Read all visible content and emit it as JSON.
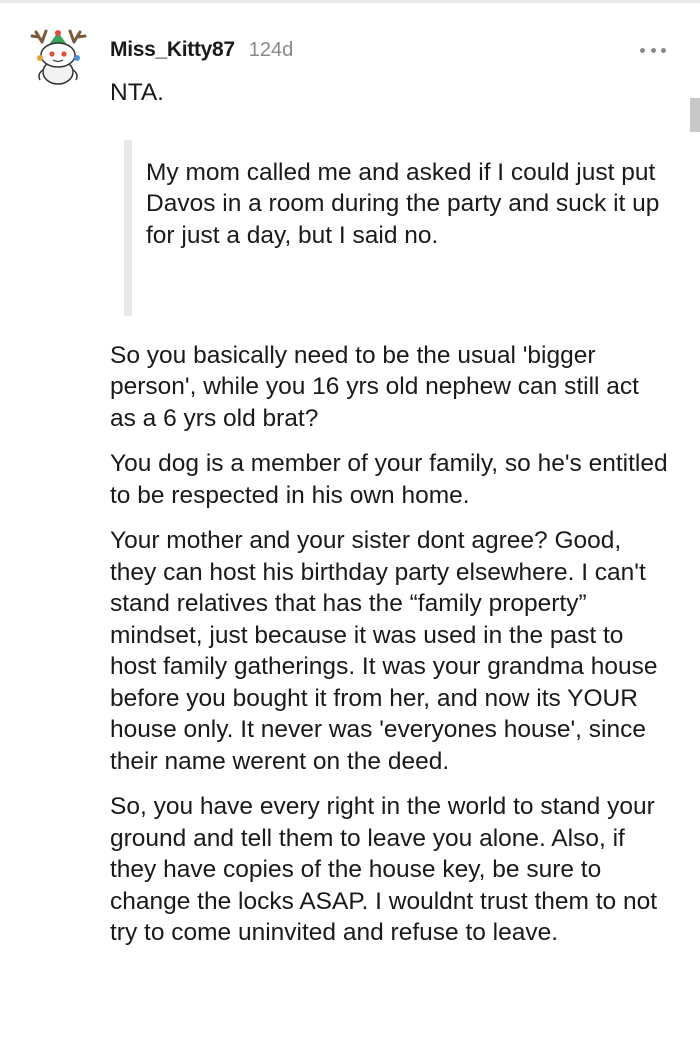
{
  "comment": {
    "username": "Miss_Kitty87",
    "age": "124d",
    "avatar_icon": "snoo-avatar-with-antlers",
    "menu_icon": "more-options-icon",
    "opening": "NTA.",
    "quote": "My mom called me and asked if I could just put Davos in a room during the party and suck it up for just a day, but I said no.",
    "paragraphs": [
      "So you basically need to be the usual 'bigger person', while you 16 yrs old nephew can still act as a 6 yrs old brat?",
      "You dog is a member of your family, so he's entitled to be respected in his own home.",
      "Your mother and your sister dont agree? Good, they can host his birthday party elsewhere. I can't stand relatives that has the “family property” mindset, just because it was used in the past to host family gatherings. It was your grandma house before you bought it from her, and now its YOUR house only. It never was 'everyones house', since their name werent on the deed.",
      "So, you have every right in the world to stand your ground and tell them to leave you alone. Also, if they have copies of the house key, be sure to change the locks ASAP. I wouldnt trust them to not try to come uninvited and refuse to leave."
    ]
  },
  "colors": {
    "text": "#1a1a1b",
    "meta": "#878a8c",
    "quote_bar": "#e8e8e8"
  }
}
